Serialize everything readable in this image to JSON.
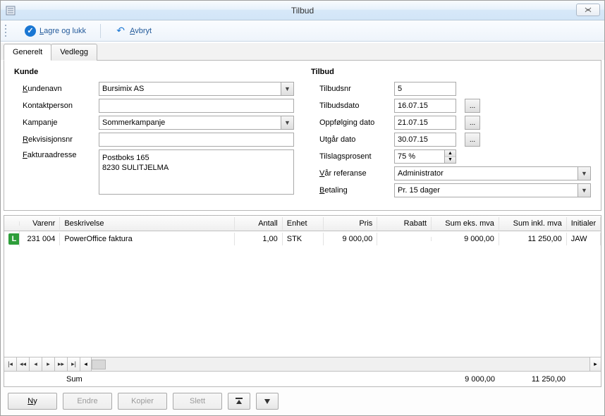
{
  "window": {
    "title": "Tilbud"
  },
  "toolbar": {
    "save_close": "Lagre og lukk",
    "cancel": "Avbryt"
  },
  "tabs": {
    "general": "Generelt",
    "attachments": "Vedlegg"
  },
  "form": {
    "kunde": {
      "heading": "Kunde",
      "kundenavn_label": "Kundenavn",
      "kundenavn_value": "Bursimix AS",
      "kontaktperson_label": "Kontaktperson",
      "kontaktperson_value": "",
      "kampanje_label": "Kampanje",
      "kampanje_value": "Sommerkampanje",
      "rekvisisjonsnr_label": "Rekvisisjonsnr",
      "rekvisisjonsnr_value": "",
      "fakturaadresse_label": "Fakturaadresse",
      "fakturaadresse_value": "Postboks 165\n8230  SULITJELMA"
    },
    "tilbud": {
      "heading": "Tilbud",
      "tilbudsnr_label": "Tilbudsnr",
      "tilbudsnr_value": "5",
      "tilbudsdato_label": "Tilbudsdato",
      "tilbudsdato_value": "16.07.15",
      "oppfolging_label": "Oppfølging dato",
      "oppfolging_value": "21.07.15",
      "utgaar_label": "Utgår dato",
      "utgaar_value": "30.07.15",
      "tilslagsprosent_label": "Tilslagsprosent",
      "tilslagsprosent_value": "75 %",
      "vaar_ref_label": "Vår referanse",
      "vaar_ref_value": "Administrator",
      "betaling_label": "Betaling",
      "betaling_value": "Pr. 15 dager"
    }
  },
  "grid": {
    "headers": {
      "varenr": "Varenr",
      "beskrivelse": "Beskrivelse",
      "antall": "Antall",
      "enhet": "Enhet",
      "pris": "Pris",
      "rabatt": "Rabatt",
      "sum_eks": "Sum eks. mva",
      "sum_inkl": "Sum inkl. mva",
      "initialer": "Initialer"
    },
    "row": {
      "icon_letter": "L",
      "varenr": "231 004",
      "beskrivelse": "PowerOffice faktura",
      "antall": "1,00",
      "enhet": "STK",
      "pris": "9 000,00",
      "rabatt": "",
      "sum_eks": "9 000,00",
      "sum_inkl": "11 250,00",
      "initialer": "JAW"
    },
    "sum": {
      "label": "Sum",
      "sum_eks": "9 000,00",
      "sum_inkl": "11 250,00"
    }
  },
  "buttons": {
    "ny": "Ny",
    "endre": "Endre",
    "kopier": "Kopier",
    "slett": "Slett"
  }
}
